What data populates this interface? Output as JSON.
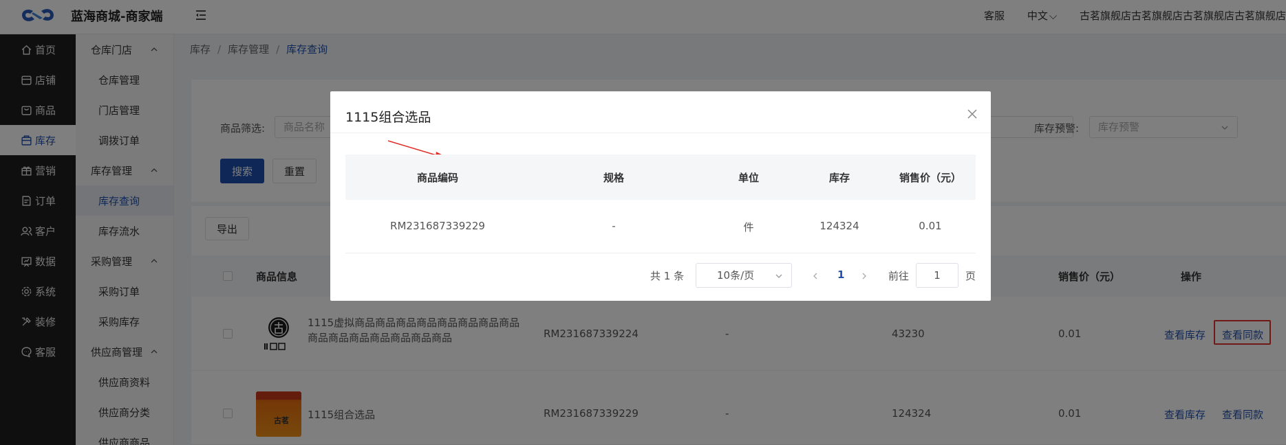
{
  "header": {
    "app_title": "蓝海商城-商家端",
    "service": "客服",
    "language": "中文",
    "store_name": "古茗旗舰店古茗旗舰店古茗旗舰店古茗旗舰店"
  },
  "sidebar": {
    "items": [
      {
        "label": "首页",
        "icon": "home-icon"
      },
      {
        "label": "店铺",
        "icon": "store-icon"
      },
      {
        "label": "商品",
        "icon": "goods-icon"
      },
      {
        "label": "库存",
        "icon": "inventory-icon"
      },
      {
        "label": "营销",
        "icon": "gift-icon"
      },
      {
        "label": "订单",
        "icon": "order-icon"
      },
      {
        "label": "客户",
        "icon": "customer-icon"
      },
      {
        "label": "数据",
        "icon": "data-icon"
      },
      {
        "label": "系统",
        "icon": "gear-icon"
      },
      {
        "label": "装修",
        "icon": "decorate-icon"
      },
      {
        "label": "客服",
        "icon": "chat-icon"
      }
    ]
  },
  "subnav": {
    "groups": [
      {
        "label": "仓库门店",
        "items": [
          "仓库管理",
          "门店管理",
          "调拨订单"
        ]
      },
      {
        "label": "库存管理",
        "items": [
          "库存查询",
          "库存流水"
        ]
      },
      {
        "label": "采购管理",
        "items": [
          "采购订单",
          "采购库存"
        ]
      },
      {
        "label": "供应商管理",
        "items": [
          "供应商资料",
          "供应商分类",
          "供应商商品"
        ]
      }
    ]
  },
  "breadcrumb": [
    "库存",
    "库存管理",
    "库存查询"
  ],
  "filters": {
    "goods_label": "商品筛选:",
    "goods_placeholder": "商品名称",
    "warning_label": "库存预警:",
    "warning_placeholder": "库存预警",
    "search_button": "搜索",
    "reset_button": "重置",
    "export_button": "导出"
  },
  "table": {
    "headers": {
      "info": "商品信息",
      "price": "销售价（元）",
      "action": "操作"
    },
    "rows": [
      {
        "name": "1115虚拟商品商品商品商品商品商品商品商品商品商品商品商品商品商品商品",
        "code": "RM231687339224",
        "spec": "-",
        "stock": "43230",
        "price": "0.01",
        "view_stock": "查看库存",
        "view_same": "查看同款"
      },
      {
        "name": "1115组合选品",
        "code": "RM231687339229",
        "spec": "-",
        "stock": "124324",
        "price": "0.01",
        "view_stock": "查看库存",
        "view_same": "查看同款"
      }
    ],
    "thumb_text": "古茗"
  },
  "modal": {
    "title": "1115组合选品",
    "headers": [
      "商品编码",
      "规格",
      "单位",
      "库存",
      "销售价（元）"
    ],
    "row": {
      "code": "RM231687339229",
      "spec": "-",
      "unit": "件",
      "stock": "124324",
      "price": "0.01"
    },
    "pagination": {
      "total": "共 1 条",
      "page_size": "10条/页",
      "current_page": "1",
      "goto_label": "前往",
      "goto_value": "1",
      "page_suffix": "页"
    }
  },
  "colors": {
    "primary": "#1e4fae",
    "highlight": "#e0302c",
    "sidebar_bg": "#1f1f1f"
  }
}
